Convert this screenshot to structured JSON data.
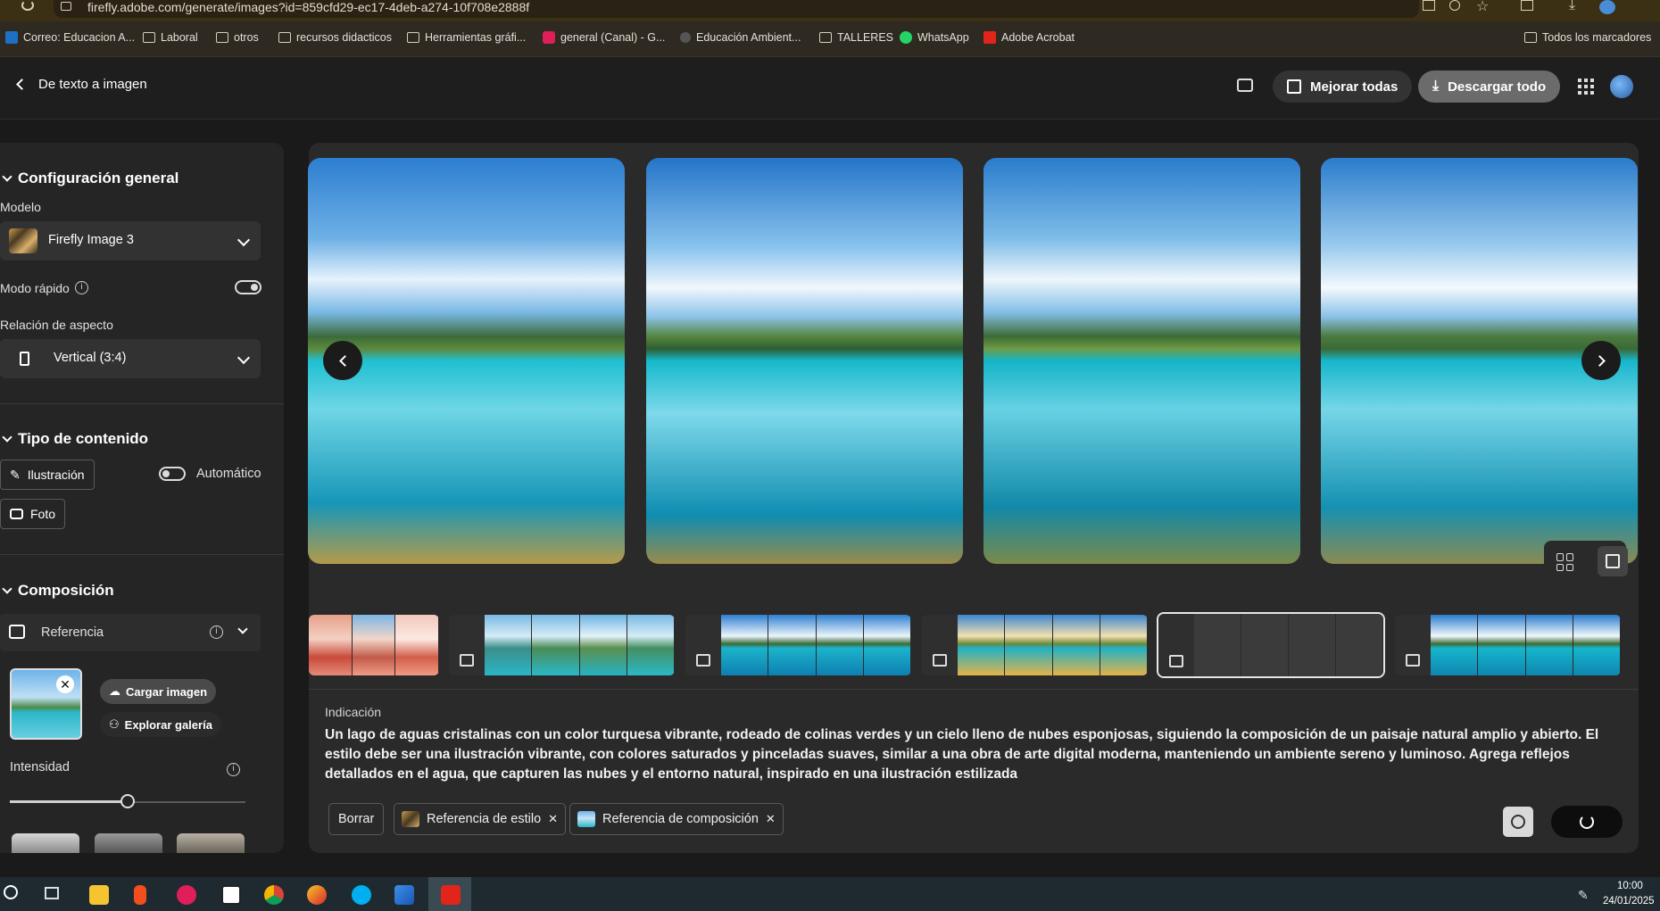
{
  "browser": {
    "url": "firefly.adobe.com/generate/images?id=859cfd29-ec17-4deb-a274-10f708e2888f",
    "bookmarks": [
      {
        "label": "Correo: Educacion A..."
      },
      {
        "label": "Laboral"
      },
      {
        "label": "otros"
      },
      {
        "label": "recursos didacticos"
      },
      {
        "label": "Herramientas gráfi..."
      },
      {
        "label": "general (Canal) - G..."
      },
      {
        "label": "Educación Ambient..."
      },
      {
        "label": "TALLERES"
      },
      {
        "label": "WhatsApp"
      },
      {
        "label": "Adobe Acrobat"
      }
    ],
    "all_bookmarks": "Todos los marcadores"
  },
  "header": {
    "back_label": "De texto a imagen",
    "improve_all": "Mejorar todas",
    "download_all": "Descargar todo"
  },
  "settings": {
    "general_title": "Configuración general",
    "model_label": "Modelo",
    "model_value": "Firefly Image 3",
    "fast_mode_label": "Modo rápido",
    "aspect_label": "Relación de aspecto",
    "aspect_value": "Vertical (3:4)",
    "content_title": "Tipo de contenido",
    "illustration": "Ilustración",
    "auto": "Automático",
    "photo": "Foto",
    "composition_title": "Composición",
    "reference": "Referencia",
    "upload": "Cargar imagen",
    "explore": "Explorar galería",
    "intensity": "Intensidad",
    "intensity_value": 0.5
  },
  "prompt": {
    "label": "Indicación",
    "text": "Un lago de aguas cristalinas con un color turquesa vibrante, rodeado de colinas verdes y un cielo lleno de nubes esponjosas, siguiendo la composición de un paisaje natural amplio y abierto. El estilo debe ser una ilustración vibrante, con colores saturados y pinceladas suaves, similar a una obra de arte digital moderna, manteniendo un ambiente sereno y luminoso. Agrega reflejos detallados en el agua, que capturen las nubes y el entorno natural, inspirado en una ilustración estilizada",
    "clear": "Borrar",
    "style_ref": "Referencia de estilo",
    "comp_ref": "Referencia de composición"
  },
  "taskbar": {
    "time": "10:00",
    "date": "24/01/2025"
  },
  "colors": {
    "accent_download": "#6b6b6b",
    "sky": "#3d8fd6",
    "water": "#19b5d0"
  }
}
